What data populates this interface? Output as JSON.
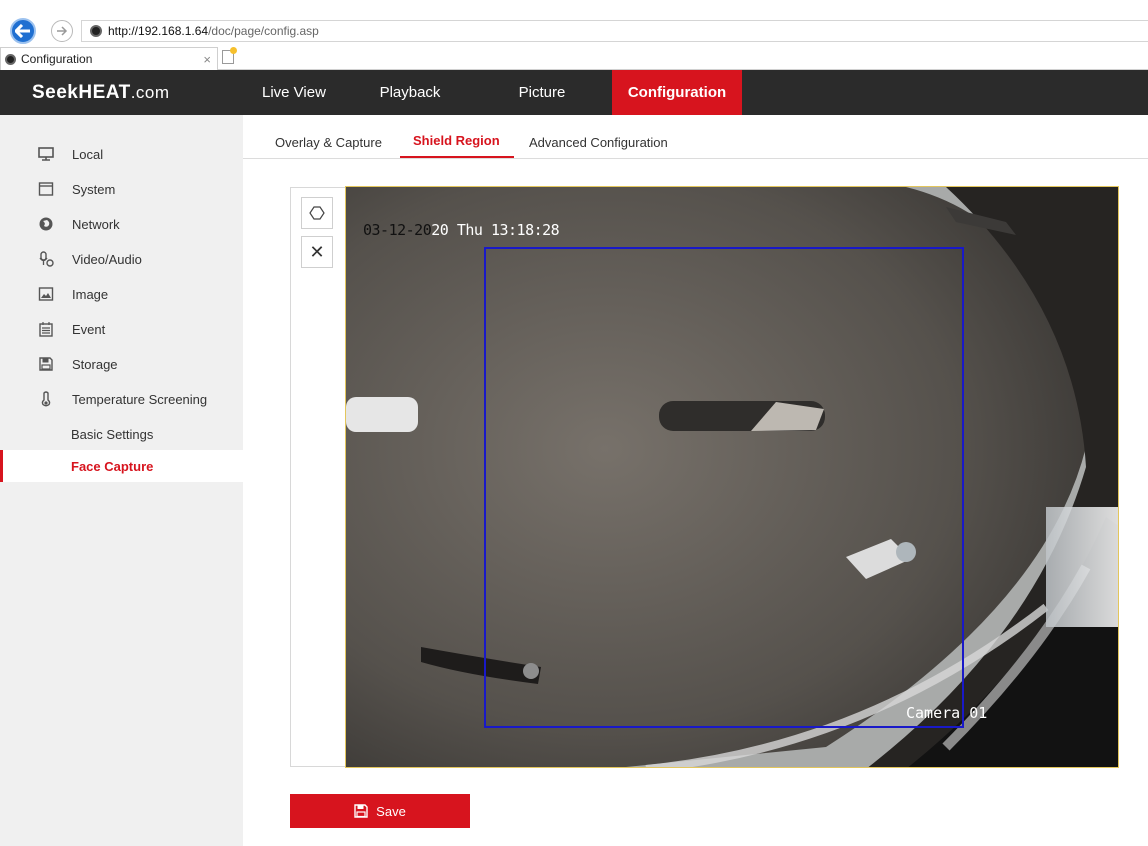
{
  "browser": {
    "url_host": "http://192.168.1.64",
    "url_path": "/doc/page/config.asp",
    "tab_title": "Configuration",
    "tab_close": "×"
  },
  "header": {
    "brand": "SeekHEAT",
    "brand_suffix": ".com",
    "nav": [
      {
        "label": "Live View"
      },
      {
        "label": "Playback"
      },
      {
        "label": "Picture"
      },
      {
        "label": "Configuration",
        "active": true
      }
    ]
  },
  "sidebar": {
    "items": [
      {
        "label": "Local",
        "icon": "monitor-icon"
      },
      {
        "label": "System",
        "icon": "window-icon"
      },
      {
        "label": "Network",
        "icon": "globe-icon"
      },
      {
        "label": "Video/Audio",
        "icon": "microphone-icon"
      },
      {
        "label": "Image",
        "icon": "image-icon"
      },
      {
        "label": "Event",
        "icon": "calendar-icon"
      },
      {
        "label": "Storage",
        "icon": "disk-icon"
      },
      {
        "label": "Temperature Screening",
        "icon": "thermometer-icon"
      }
    ],
    "subitems": [
      {
        "label": "Basic Settings",
        "active": false
      },
      {
        "label": "Face Capture",
        "active": true
      }
    ]
  },
  "subtabs": [
    {
      "label": "Overlay & Capture"
    },
    {
      "label": "Shield Region",
      "active": true
    },
    {
      "label": "Advanced Configuration"
    }
  ],
  "video": {
    "timestamp_dark": "03-12-20",
    "timestamp_light": "20 Thu 13:18:28",
    "camera_label": "Camera 01",
    "tools": [
      {
        "name": "draw-area",
        "icon": "hexagon-icon"
      },
      {
        "name": "clear-all",
        "icon": "close-icon",
        "glyph": "✕"
      }
    ]
  },
  "actions": {
    "save_label": "Save"
  },
  "colors": {
    "accent": "#d7141e",
    "header_bg": "#2b2b2b",
    "shield_region": "#1919c8",
    "sidebar_bg": "#f0f0f0"
  }
}
